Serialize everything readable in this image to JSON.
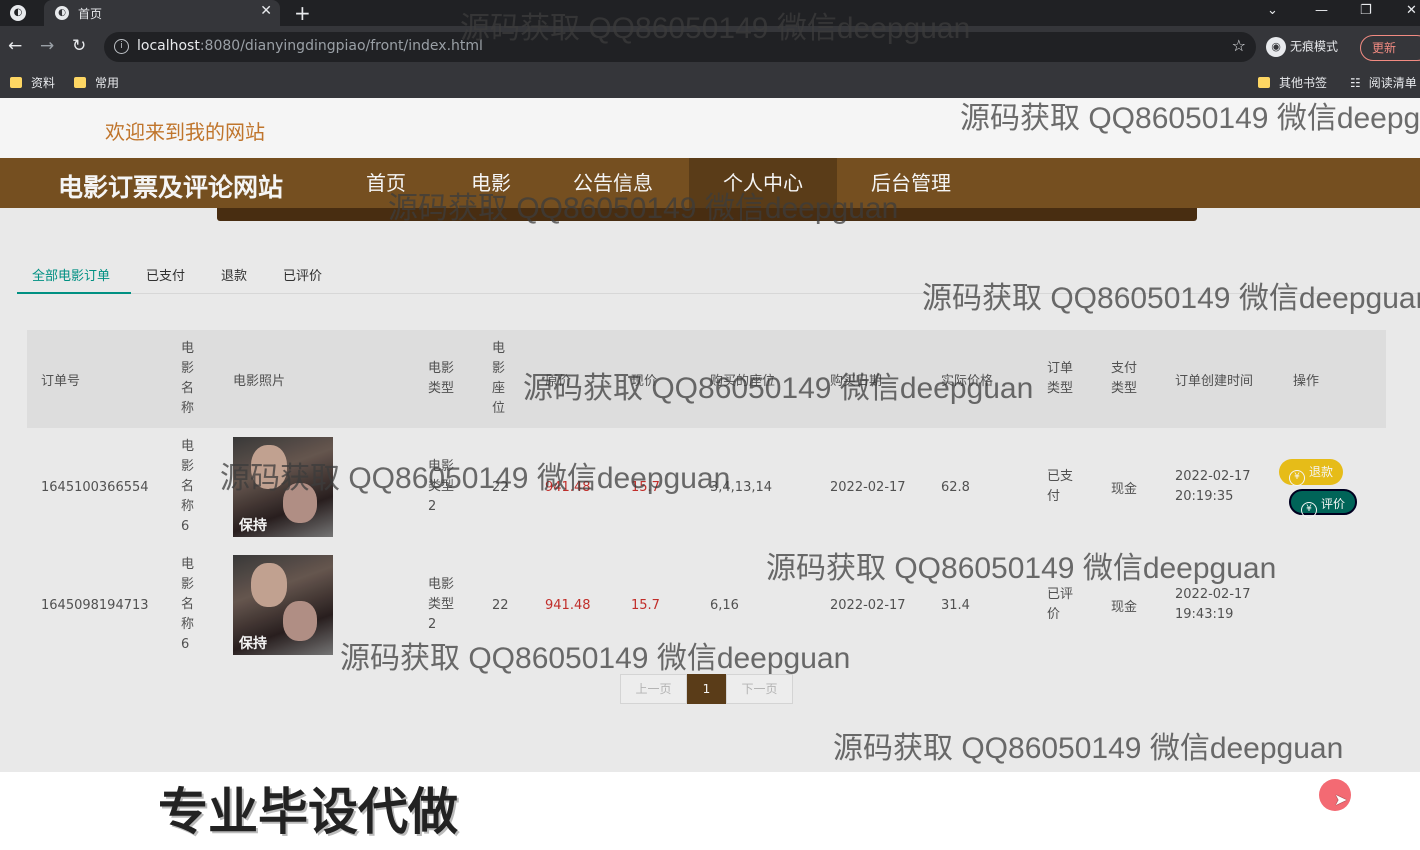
{
  "browser": {
    "tab_title": "首页",
    "url_host": "localhost",
    "url_rest": ":8080/dianyingdingpiao/front/index.html",
    "profile_label": "无痕模式",
    "update_label": "更新",
    "bookmarks": [
      "资料",
      "常用"
    ],
    "bookmarks_right": [
      "其他书签",
      "阅读清单"
    ]
  },
  "site": {
    "welcome": "欢迎来到我的网站",
    "title": "电影订票及评论网站",
    "nav": [
      "首页",
      "电影",
      "公告信息",
      "个人中心",
      "后台管理"
    ],
    "active_nav": "个人中心"
  },
  "order_tabs": [
    "全部电影订单",
    "已支付",
    "退款",
    "已评价"
  ],
  "table": {
    "headers": [
      "订单号",
      "电影名称",
      "电影照片",
      "电影类型",
      "电影座位",
      "原价",
      "现价",
      "购买的座位",
      "购买日期",
      "实际价格",
      "订单类型",
      "支付类型",
      "订单创建时间",
      "操作"
    ],
    "rows": [
      {
        "order_no": "1645100366554",
        "movie_name": "电影名称6",
        "poster_text": "保持",
        "movie_type": "电影类型2",
        "seat": "22",
        "orig_price": "941.48",
        "price": "15.7",
        "seats_bought": "3,4,13,14",
        "date": "2022-02-17",
        "actual_price": "62.8",
        "order_type": "已支付",
        "pay_type": "现金",
        "created": "2022-02-17 20:19:35",
        "btn_refund": "退款",
        "btn_review": "评价"
      },
      {
        "order_no": "1645098194713",
        "movie_name": "电影名称6",
        "poster_text": "保持",
        "movie_type": "电影类型2",
        "seat": "22",
        "orig_price": "941.48",
        "price": "15.7",
        "seats_bought": "6,16",
        "date": "2022-02-17",
        "actual_price": "31.4",
        "order_type": "已评价",
        "pay_type": "现金",
        "created": "2022-02-17 19:43:19"
      }
    ]
  },
  "pager": {
    "prev": "上一页",
    "current": "1",
    "next": "下一页"
  },
  "promo": "专业毕设代做",
  "watermark": "源码获取 QQ86050149 微信deepguan"
}
